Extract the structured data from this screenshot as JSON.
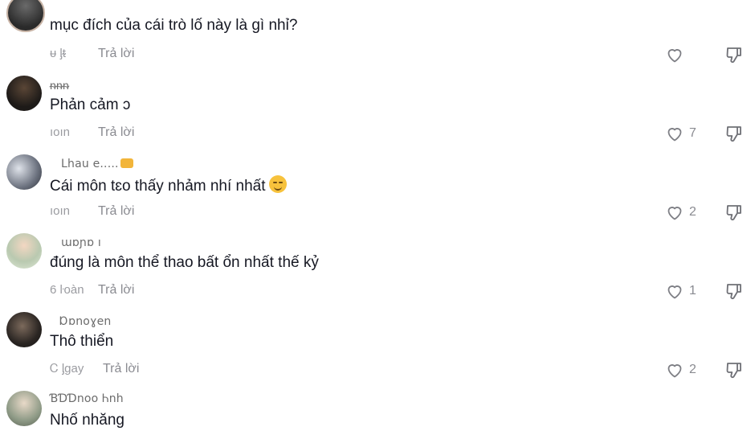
{
  "comments": [
    {
      "username": "",
      "text": "mục đích của cái trò lố này là gì nhỉ?",
      "time": "ᵾ ᶅᵵ",
      "reply": "Trả lời",
      "likes": ""
    },
    {
      "username": "ᵰᵰᵰ",
      "text": "Phản cảm",
      "suffix": "ↄ",
      "time": "ıoın",
      "reply": "Trả lời",
      "likes": "7"
    },
    {
      "username": "Lhau e.....",
      "text": "Cái môn tɛo thấy nhảm nhí nhất",
      "time": "ıoın",
      "reply": "Trả lời",
      "likes": "2"
    },
    {
      "username": "ɯɒɲɒ ı",
      "text": "đúng là môn thể thao bất ổn nhất thế kỷ",
      "time": "6 ŀoàn",
      "reply": "Trả lời",
      "likes": "1"
    },
    {
      "username": "Ɒɒnoɣen",
      "text": "Thô thiển",
      "time": "Ꮯ ᶅgay",
      "reply": "Trả lời",
      "likes": "2"
    },
    {
      "username": "ƁƊƊnoo Ꮒnh",
      "text": "Nhố nhăng"
    }
  ],
  "colors": {
    "text": "#161823",
    "secondary": "#8a8b91"
  },
  "icons": {
    "like": "heart-outline-icon",
    "dislike": "thumbs-down-icon"
  }
}
